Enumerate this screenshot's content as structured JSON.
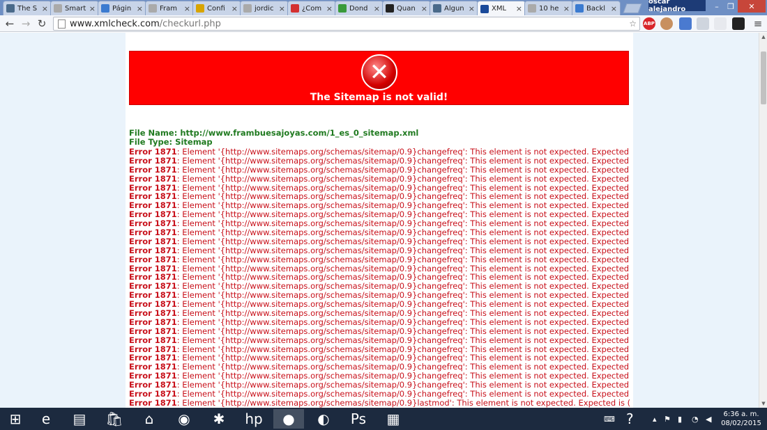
{
  "browser": {
    "tabs": [
      {
        "label": "The S",
        "color": "#4a6a8a"
      },
      {
        "label": "Smart",
        "color": "#aaaaaa"
      },
      {
        "label": "Págin",
        "color": "#3b7bd0"
      },
      {
        "label": "Fram",
        "color": "#aaaaaa"
      },
      {
        "label": "Confi",
        "color": "#d8a400"
      },
      {
        "label": "jordic",
        "color": "#aaaaaa"
      },
      {
        "label": "¿Com",
        "color": "#d43030"
      },
      {
        "label": "Dond",
        "color": "#3a9a3a"
      },
      {
        "label": "Quan",
        "color": "#222222"
      },
      {
        "label": "Algun",
        "color": "#4a6a8a"
      },
      {
        "label": "XML",
        "color": "#1a4a9a"
      },
      {
        "label": "10 he",
        "color": "#aaaaaa"
      },
      {
        "label": "Backl",
        "color": "#3b7bd0"
      }
    ],
    "active_tab": 10,
    "profile_name": "oscar alejandro",
    "window_controls": {
      "minimize": "–",
      "maximize": "❐",
      "close": "✕"
    },
    "nav": {
      "back": "←",
      "forward": "→",
      "reload": "↻"
    },
    "url_host": "www.xmlcheck.com",
    "url_path": "/checkurl.php",
    "extensions": [
      "ABP"
    ]
  },
  "page": {
    "banner_title": "The Sitemap is not valid!",
    "file_name_label": "File Name:",
    "file_name_value": "http://www.frambuesajoyas.com/1_es_0_sitemap.xml",
    "file_type_label": "File Type:",
    "file_type_value": "Sitemap",
    "errors": [
      {
        "code": "Error 1871",
        "message": ": Element '{http://www.sitemaps.org/schemas/sitemap/0.9}changefreq': This element is not expected. Expected is ( ##"
      },
      {
        "code": "Error 1871",
        "message": ": Element '{http://www.sitemaps.org/schemas/sitemap/0.9}changefreq': This element is not expected. Expected is ( ##"
      },
      {
        "code": "Error 1871",
        "message": ": Element '{http://www.sitemaps.org/schemas/sitemap/0.9}changefreq': This element is not expected. Expected is ( ##"
      },
      {
        "code": "Error 1871",
        "message": ": Element '{http://www.sitemaps.org/schemas/sitemap/0.9}changefreq': This element is not expected. Expected is ( ##"
      },
      {
        "code": "Error 1871",
        "message": ": Element '{http://www.sitemaps.org/schemas/sitemap/0.9}changefreq': This element is not expected. Expected is ( ##"
      },
      {
        "code": "Error 1871",
        "message": ": Element '{http://www.sitemaps.org/schemas/sitemap/0.9}changefreq': This element is not expected. Expected is ( ##"
      },
      {
        "code": "Error 1871",
        "message": ": Element '{http://www.sitemaps.org/schemas/sitemap/0.9}changefreq': This element is not expected. Expected is ( ##"
      },
      {
        "code": "Error 1871",
        "message": ": Element '{http://www.sitemaps.org/schemas/sitemap/0.9}changefreq': This element is not expected. Expected is ( ##"
      },
      {
        "code": "Error 1871",
        "message": ": Element '{http://www.sitemaps.org/schemas/sitemap/0.9}changefreq': This element is not expected. Expected is ( ##"
      },
      {
        "code": "Error 1871",
        "message": ": Element '{http://www.sitemaps.org/schemas/sitemap/0.9}changefreq': This element is not expected. Expected is ( ##"
      },
      {
        "code": "Error 1871",
        "message": ": Element '{http://www.sitemaps.org/schemas/sitemap/0.9}changefreq': This element is not expected. Expected is ( ##"
      },
      {
        "code": "Error 1871",
        "message": ": Element '{http://www.sitemaps.org/schemas/sitemap/0.9}changefreq': This element is not expected. Expected is ( ##"
      },
      {
        "code": "Error 1871",
        "message": ": Element '{http://www.sitemaps.org/schemas/sitemap/0.9}changefreq': This element is not expected. Expected is ( ##"
      },
      {
        "code": "Error 1871",
        "message": ": Element '{http://www.sitemaps.org/schemas/sitemap/0.9}changefreq': This element is not expected. Expected is ( ##"
      },
      {
        "code": "Error 1871",
        "message": ": Element '{http://www.sitemaps.org/schemas/sitemap/0.9}changefreq': This element is not expected. Expected is ( ##"
      },
      {
        "code": "Error 1871",
        "message": ": Element '{http://www.sitemaps.org/schemas/sitemap/0.9}changefreq': This element is not expected. Expected is ( ##"
      },
      {
        "code": "Error 1871",
        "message": ": Element '{http://www.sitemaps.org/schemas/sitemap/0.9}changefreq': This element is not expected. Expected is ( ##"
      },
      {
        "code": "Error 1871",
        "message": ": Element '{http://www.sitemaps.org/schemas/sitemap/0.9}changefreq': This element is not expected. Expected is ( ##"
      },
      {
        "code": "Error 1871",
        "message": ": Element '{http://www.sitemaps.org/schemas/sitemap/0.9}changefreq': This element is not expected. Expected is ( ##"
      },
      {
        "code": "Error 1871",
        "message": ": Element '{http://www.sitemaps.org/schemas/sitemap/0.9}changefreq': This element is not expected. Expected is ( ##"
      },
      {
        "code": "Error 1871",
        "message": ": Element '{http://www.sitemaps.org/schemas/sitemap/0.9}changefreq': This element is not expected. Expected is ( ##"
      },
      {
        "code": "Error 1871",
        "message": ": Element '{http://www.sitemaps.org/schemas/sitemap/0.9}changefreq': This element is not expected. Expected is ( ##"
      },
      {
        "code": "Error 1871",
        "message": ": Element '{http://www.sitemaps.org/schemas/sitemap/0.9}changefreq': This element is not expected. Expected is ( ##"
      },
      {
        "code": "Error 1871",
        "message": ": Element '{http://www.sitemaps.org/schemas/sitemap/0.9}changefreq': This element is not expected. Expected is ( ##"
      },
      {
        "code": "Error 1871",
        "message": ": Element '{http://www.sitemaps.org/schemas/sitemap/0.9}changefreq': This element is not expected. Expected is ( ##"
      },
      {
        "code": "Error 1871",
        "message": ": Element '{http://www.sitemaps.org/schemas/sitemap/0.9}changefreq': This element is not expected. Expected is ( ##"
      },
      {
        "code": "Error 1871",
        "message": ": Element '{http://www.sitemaps.org/schemas/sitemap/0.9}changefreq': This element is not expected. Expected is ( ##"
      },
      {
        "code": "Error 1871",
        "message": ": Element '{http://www.sitemaps.org/schemas/sitemap/0.9}changefreq': This element is not expected. Expected is ( ##"
      },
      {
        "code": "Error 1871",
        "message": ": Element '{http://www.sitemaps.org/schemas/sitemap/0.9}lastmod': This element is not expected. Expected is ( ##oth"
      }
    ],
    "colors": {
      "banner": "#ff0000",
      "info_text": "#207a20",
      "error_text": "#c8101a",
      "background": "#eaf3fb"
    }
  },
  "taskbar": {
    "apps": [
      {
        "name": "start-button",
        "glyph": "⊞"
      },
      {
        "name": "internet-explorer",
        "glyph": "e"
      },
      {
        "name": "file-explorer",
        "glyph": "▤"
      },
      {
        "name": "store",
        "glyph": "🛍"
      },
      {
        "name": "home",
        "glyph": "⌂"
      },
      {
        "name": "webcam",
        "glyph": "◉"
      },
      {
        "name": "paint-app",
        "glyph": "✱"
      },
      {
        "name": "hp",
        "glyph": "hp"
      },
      {
        "name": "chrome",
        "glyph": "●"
      },
      {
        "name": "firefox",
        "glyph": "◐"
      },
      {
        "name": "photoshop",
        "glyph": "Ps"
      },
      {
        "name": "paint",
        "glyph": "▦"
      }
    ],
    "active_app": 8,
    "clock_time": "6:36 a. m.",
    "clock_date": "08/02/2015"
  }
}
